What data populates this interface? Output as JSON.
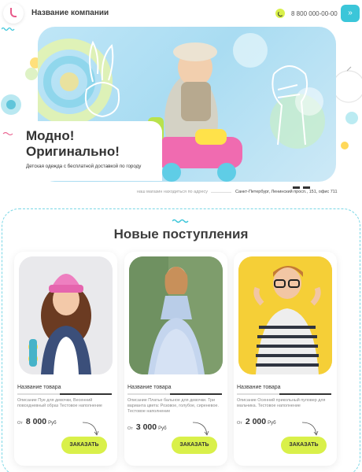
{
  "header": {
    "company_name": "Название компании",
    "phone": "8 800 000-00-00",
    "phone_icon": "phone-icon",
    "menu_icon": "chevrons-right-icon",
    "accent_color": "#3bc6d9",
    "highlight_color": "#d9f04a"
  },
  "hero": {
    "title_line1": "Модно!",
    "title_line2": "Оригинально!",
    "subtitle": "Детская одежда с бесплатной доставкой по городу",
    "address_label": "наш магазин находиться по адресу",
    "address_value": "Санкт-Петербург, Ленинский просп., 151, офис 711"
  },
  "section": {
    "title": "Новые поступления"
  },
  "products": [
    {
      "name": "Название товара",
      "description": "Описание Пуе для девочки, Весенний повседневный образ Тестовое наполнение",
      "price_from": "От",
      "price": "8 000",
      "currency": "Руб",
      "button": "ЗАКАЗАТЬ"
    },
    {
      "name": "Название товара",
      "description": "Описание Платье бальное для девочки. Три варианта цвета: Розовое, голубое, сиреневое. Тестовое наполнение",
      "price_from": "От",
      "price": "3 000",
      "currency": "Руб",
      "button": "ЗАКАЗАТЬ"
    },
    {
      "name": "Название товара",
      "description": "Описание Осенний прикольный пуловер для мальчика. Тестовое наполнение",
      "price_from": "От",
      "price": "2 000",
      "currency": "Руб",
      "button": "ЗАКАЗАТЬ"
    }
  ]
}
